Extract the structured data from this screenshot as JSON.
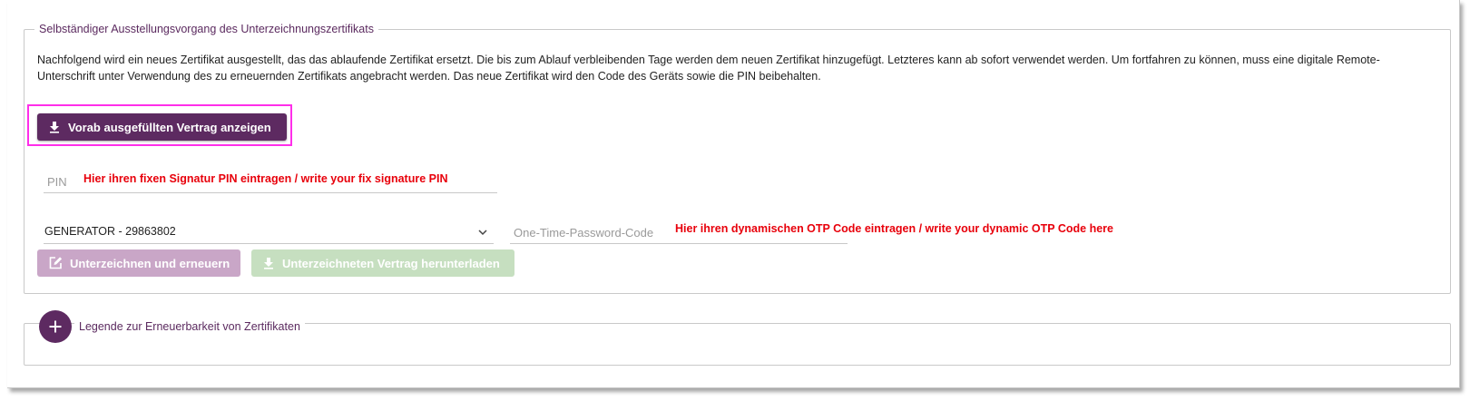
{
  "section": {
    "title": "Selbständiger Ausstellungsvorgang des Unterzeichnungszertifikats",
    "intro": "Nachfolgend wird ein neues Zertifikat ausgestellt, das das ablaufende Zertifikat ersetzt. Die bis zum Ablauf verbleibenden Tage werden dem neuen Zertifikat hinzugefügt. Letzteres kann ab sofort verwendet werden. Um fortfahren zu können, muss eine digitale Remote-Unterschrift unter Verwendung des zu erneuernden Zertifikats angebracht werden. Das neue Zertifikat wird den Code des Geräts sowie die PIN beibehalten."
  },
  "buttons": {
    "preview_contract": "Vorab ausgefüllten Vertrag anzeigen",
    "sign_renew": "Unterzeichnen und erneuern",
    "download_signed": "Unterzeichneten Vertrag herunterladen"
  },
  "pin": {
    "placeholder": "PIN",
    "value": "",
    "annotation": "Hier ihren fixen Signatur PIN eintragen / write your fix signature PIN"
  },
  "device_select": {
    "selected": "GENERATOR - 29863802"
  },
  "otp": {
    "placeholder": "One-Time-Password-Code",
    "value": "",
    "annotation": "Hier ihren dynamischen OTP Code eintragen / write your dynamic OTP Code here"
  },
  "legend_section": {
    "title": "Legende zur Erneuerbarkeit von Zertifikaten"
  },
  "icons": {
    "download": "download-icon",
    "edit": "edit-icon",
    "chevron": "chevron-down-icon",
    "plus": "plus-icon"
  },
  "colors": {
    "primary": "#5d2a61",
    "primary_disabled": "#c9a6c7",
    "success_disabled": "#c6dfc0",
    "highlight": "#ff2eea",
    "annotation": "#e8000b"
  }
}
